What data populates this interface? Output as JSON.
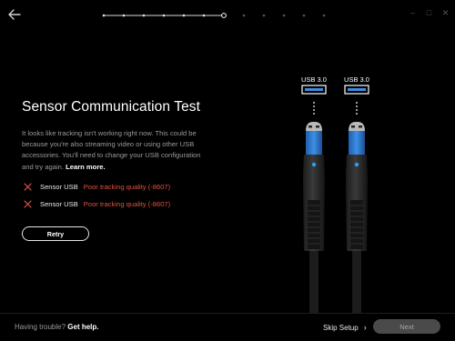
{
  "header": {
    "back_icon": "arrow-left-icon",
    "progress": {
      "total_steps": 12,
      "current_step": 7
    },
    "window_controls": [
      "minimize-icon",
      "maximize-icon",
      "close-icon"
    ]
  },
  "main": {
    "title": "Sensor Communication Test",
    "description": "It looks like tracking isn't working right now. This could be because you're also streaming video or using other USB accessories. You'll need to change your USB configuration and try again.",
    "learn_more": "Learn more.",
    "status_items": [
      {
        "icon": "x-icon",
        "label": "Sensor USB",
        "status": "Poor tracking quality (-8607)"
      },
      {
        "icon": "x-icon",
        "label": "Sensor USB",
        "status": "Poor tracking quality (-8607)"
      }
    ],
    "retry_label": "Retry"
  },
  "illustration": {
    "port_labels": [
      "USB 3.0",
      "USB 3.0"
    ],
    "connector_color": "#2f7fd6",
    "indicator_color": "#1aa6ff"
  },
  "footer": {
    "trouble_text": "Having trouble?",
    "help_link": "Get help.",
    "skip_label": "Skip Setup",
    "next_label": "Next"
  },
  "colors": {
    "background": "#000000",
    "error": "#e0523f",
    "muted_text": "#9a9a9a",
    "disabled_button": "#4a4a4a"
  }
}
